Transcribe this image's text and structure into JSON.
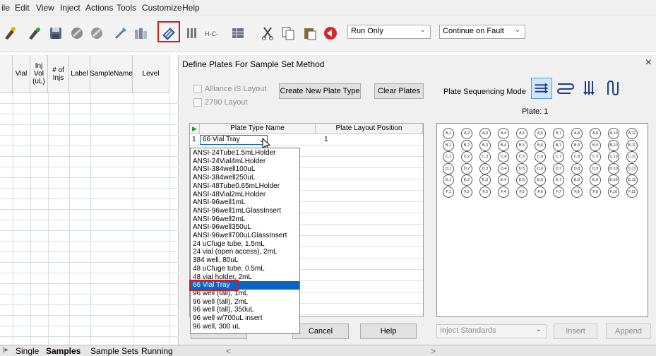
{
  "menu": [
    "ile",
    "Edit",
    "View",
    "Inject",
    "Actions",
    "Tools",
    "Customize",
    "Help"
  ],
  "toolbar": {
    "run_mode": "Run Only",
    "fault_mode": "Continue on Fault"
  },
  "left_grid": {
    "headers": [
      "Vial",
      "Inj\nVol\n(uL)",
      "# of\nInjs",
      "Label",
      "SampleName",
      "Level"
    ]
  },
  "dialog": {
    "title": "Define Plates For Sample Set Method",
    "close": "×",
    "alliance_label": "Alliance iS Layout",
    "layout2790_label": "2790 Layout",
    "create_button": "Create New Plate Type",
    "clear_button": "Clear Plates",
    "sequencing_label": "Plate Sequencing Mode",
    "plate_label": "Plate:  1",
    "table_headers": [
      "Plate Type Name",
      "Plate Layout Position"
    ],
    "row_number": "1",
    "selected_type": "66 Vial Tray",
    "row_position": "1",
    "ok_button": "OK",
    "cancel_button": "Cancel",
    "help_button": "Help",
    "inject_standards": "Inject Standards",
    "insert_button": "Insert",
    "append_button": "Append"
  },
  "plate_types": [
    "ANSI-24Tube1.5mLHolder",
    "ANSI-24Vial4mLHolder",
    "ANSI-384well100uL",
    "ANSI-384well250uL",
    "ANSI-48Tube0.65mLHolder",
    "ANSI-48Vial2mLHolder",
    "ANSI-96well1mL",
    "ANSI-96well1mLGlassInsert",
    "ANSI-96well2mL",
    "ANSI-96well350uL",
    "ANSI-96well700uLGlassInsert",
    "24 uCfuge tube, 1.5mL",
    "24 vial (open access), 2mL",
    "384 well, 80uL",
    "48 uCfuge tube, 0.5mL",
    "48 vial holder, 2mL",
    "66 Vial Tray",
    "96 well (tall), 1mL",
    "96 well (tall), 2mL",
    "96 well (tall), 350uL",
    "96 well w/700uL insert",
    "96 well, 300 uL"
  ],
  "selected_index": 16,
  "vial_rows": [
    "A",
    "B",
    "C",
    "D",
    "E",
    "F"
  ],
  "vial_cols": [
    "1",
    "2",
    "3",
    "4",
    "5",
    "6",
    "7",
    "8",
    "9",
    "10",
    "11"
  ],
  "tabs": [
    "Single",
    "Samples",
    "Sample Sets",
    "Running"
  ]
}
